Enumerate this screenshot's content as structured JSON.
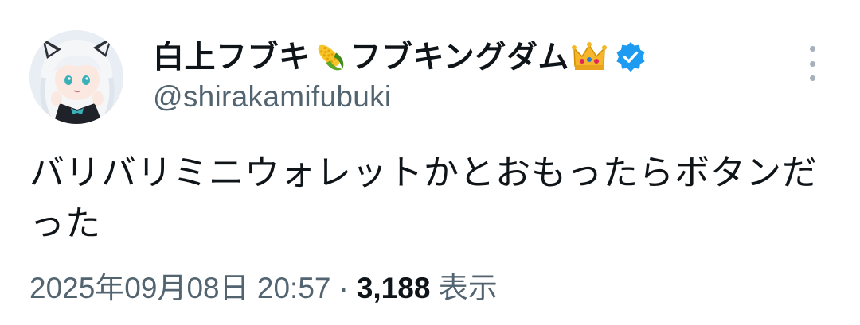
{
  "tweet": {
    "display_name_part1": "白上フブキ",
    "emoji_corn": "corn-emoji",
    "display_name_part2": "フブキングダム",
    "emoji_crown": "crown-emoji",
    "verified_icon": "verified-badge-icon",
    "handle": "@shirakamifubuki",
    "text": "バリバリミニウォレットかとおもったらボタンだった",
    "timestamp": "2025年09月08日 20:57",
    "separator": "·",
    "views_count": "3,188",
    "views_label": "表示",
    "colors": {
      "verified_blue": "#1d9bf0",
      "secondary_text": "#536471",
      "primary_text": "#0f1419"
    }
  }
}
